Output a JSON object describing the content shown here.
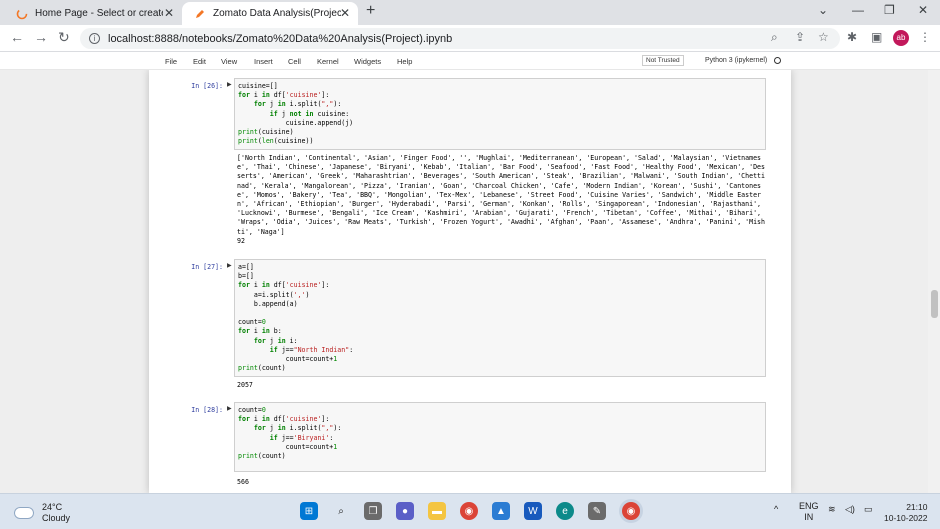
{
  "browser": {
    "tabs": [
      {
        "title": "Home Page - Select or create a n",
        "close": "✕"
      },
      {
        "title": "Zomato Data Analysis(Project) - ",
        "close": "✕"
      }
    ],
    "new_tab": "+",
    "url": "localhost:8888/notebooks/Zomato%20Data%20Analysis(Project).ipynb",
    "profile_initials": "ab",
    "window_controls": [
      "⌄",
      "—",
      "❐",
      "✕"
    ]
  },
  "jupyter": {
    "menu": [
      "File",
      "Edit",
      "View",
      "Insert",
      "Cell",
      "Kernel",
      "Widgets",
      "Help"
    ],
    "trust_status": "Not Trusted",
    "kernel_name": "Python 3 (ipykernel)"
  },
  "cells": [
    {
      "prompt": "In [26]:",
      "source": [
        "cuisine=[]",
        "for i in df['cuisine']:",
        "    for j in i.split(\",\"):",
        "        if j not in cuisine:",
        "            cuisine.append(j)",
        "print(cuisine)",
        "print(len(cuisine))"
      ],
      "output": "['North Indian', 'Continental', 'Asian', 'Finger Food', '', 'Mughlai', 'Mediterranean', 'European', 'Salad', 'Malaysian', 'Vietnamese', 'Thai', 'Chinese', 'Japanese', 'Biryani', 'Kebab', 'Italian', 'Bar Food', 'Seafood', 'Fast Food', 'Healthy Food', 'Mexican', 'Desserts', 'American', 'Greek', 'Maharashtrian', 'Beverages', 'South American', 'Steak', 'Brazilian', 'Malwani', 'South Indian', 'Chettinad', 'Kerala', 'Mangalorean', 'Pizza', 'Iranian', 'Goan', 'Charcoal Chicken', 'Cafe', 'Modern Indian', 'Korean', 'Sushi', 'Cantonese', 'Momos', 'Bakery', 'Tea', 'BBQ', 'Mongolian', 'Tex-Mex', 'Lebanese', 'Street Food', 'Cuisine Varies', 'Sandwich', 'Middle Eastern', 'African', 'Ethiopian', 'Burger', 'Hyderabadi', 'Parsi', 'German', 'Konkan', 'Rolls', 'Singaporean', 'Indonesian', 'Rajasthani', 'Lucknowi', 'Burmese', 'Bengali', 'Ice Cream', 'Kashmiri', 'Arabian', 'Gujarati', 'French', 'Tibetan', 'Coffee', 'Mithai', 'Bihari', 'Wraps', 'Odia', 'Juices', 'Raw Meats', 'Turkish', 'Frozen Yogurt', 'Awadhi', 'Afghan', 'Paan', 'Assamese', 'Andhra', 'Panini', 'Mishti', 'Naga']\n92"
    },
    {
      "prompt": "In [27]:",
      "source": [
        "a=[]",
        "b=[]",
        "for i in df['cuisine']:",
        "    a=i.split(',')",
        "    b.append(a)",
        "",
        "count=0",
        "for i in b:",
        "    for j in i:",
        "        if j==\"North Indian\":",
        "            count=count+1",
        "print(count)"
      ],
      "output": "2057"
    },
    {
      "prompt": "In [28]:",
      "source": [
        "count=0",
        "for i in df['cuisine']:",
        "    for j in i.split(\",\"):",
        "        if j=='Biryani':",
        "            count=count+1",
        "print(count)"
      ],
      "output": "566"
    }
  ],
  "taskbar": {
    "weather_temp": "24°C",
    "weather_desc": "Cloudy",
    "lang_line1": "ENG",
    "lang_line2": "IN",
    "time": "21:10",
    "date": "10-10-2022",
    "tray_chevron": "^"
  }
}
